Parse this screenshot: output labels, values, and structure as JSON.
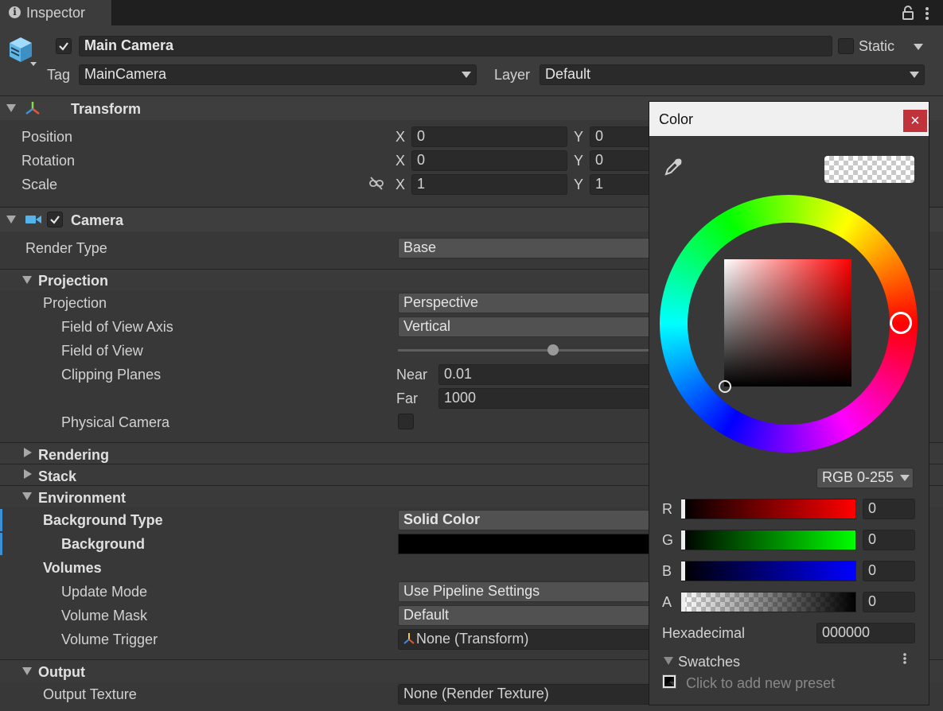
{
  "tab": {
    "title": "Inspector"
  },
  "object": {
    "name": "Main Camera",
    "active": true,
    "static_label": "Static",
    "tag_label": "Tag",
    "tag_value": "MainCamera",
    "layer_label": "Layer",
    "layer_value": "Default"
  },
  "transform": {
    "title": "Transform",
    "rows": [
      {
        "label": "Position",
        "x": "0",
        "y": "0"
      },
      {
        "label": "Rotation",
        "x": "0",
        "y": "0"
      },
      {
        "label": "Scale",
        "x": "1",
        "y": "1"
      }
    ],
    "axis_x": "X",
    "axis_y": "Y"
  },
  "camera": {
    "title": "Camera",
    "render_type_label": "Render Type",
    "render_type_value": "Base",
    "projection_section": "Projection",
    "projection_label": "Projection",
    "projection_value": "Perspective",
    "fov_axis_label": "Field of View Axis",
    "fov_axis_value": "Vertical",
    "fov_label": "Field of View",
    "clipping_label": "Clipping Planes",
    "near_label": "Near",
    "near_value": "0.01",
    "far_label": "Far",
    "far_value": "1000",
    "physical_label": "Physical Camera",
    "rendering_section": "Rendering",
    "stack_section": "Stack",
    "environment_section": "Environment",
    "bg_type_label": "Background Type",
    "bg_type_value": "Solid Color",
    "background_label": "Background",
    "background_color": "#000000",
    "volumes_label": "Volumes",
    "update_mode_label": "Update Mode",
    "update_mode_value": "Use Pipeline Settings",
    "volume_mask_label": "Volume Mask",
    "volume_mask_value": "Default",
    "volume_trigger_label": "Volume Trigger",
    "volume_trigger_value": "None (Transform)",
    "output_section": "Output",
    "output_texture_label": "Output Texture",
    "output_texture_value": "None (Render Texture)"
  },
  "color_picker": {
    "title": "Color",
    "close_glyph": "×",
    "mode": "RGB 0-255",
    "channels": [
      {
        "label": "R",
        "value": "0"
      },
      {
        "label": "G",
        "value": "0"
      },
      {
        "label": "B",
        "value": "0"
      },
      {
        "label": "A",
        "value": "0"
      }
    ],
    "hex_label": "Hexadecimal",
    "hex_value": "000000",
    "swatches_label": "Swatches",
    "preset_hint": "Click to add new preset"
  },
  "colors": {
    "accent": "#3a8fd6",
    "close_button": "#c0333a"
  }
}
